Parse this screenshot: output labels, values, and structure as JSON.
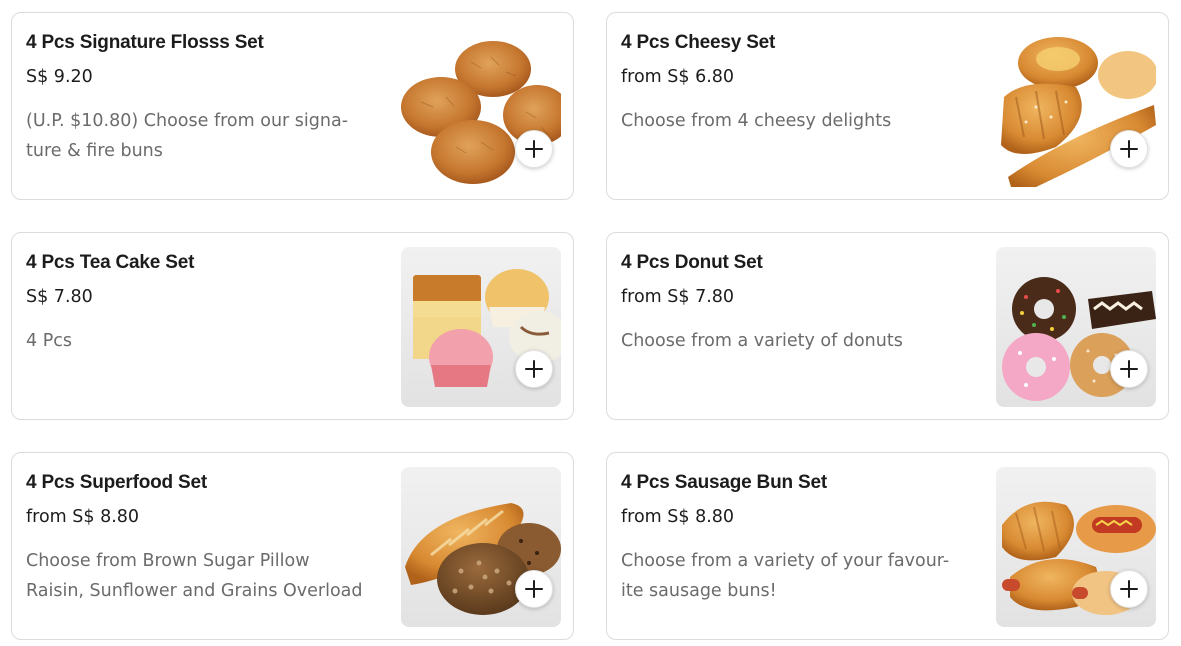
{
  "menu": {
    "items": [
      {
        "title": "4 Pcs Signature Flosss Set",
        "price": "S$ 9.20",
        "description_lines": [
          "(U.P. $10.80) Choose from our signa-",
          "ture & fire buns"
        ],
        "image": "floss-buns"
      },
      {
        "title": "4 Pcs Cheesy Set",
        "price": "from S$ 6.80",
        "description_lines": [
          "Choose from 4 cheesy delights",
          ""
        ],
        "image": "cheesy-breads"
      },
      {
        "title": "4 Pcs Tea Cake Set",
        "price": "S$ 7.80",
        "description_lines": [
          "4 Pcs",
          ""
        ],
        "image": "tea-cakes"
      },
      {
        "title": "4 Pcs Donut Set",
        "price": "from S$ 7.80",
        "description_lines": [
          "Choose from a variety of donuts",
          ""
        ],
        "image": "donuts"
      },
      {
        "title": "4 Pcs Superfood Set",
        "price": "from S$ 8.80",
        "description_lines": [
          "Choose from Brown Sugar Pillow",
          "Raisin, Sunflower and Grains Overload"
        ],
        "image": "superfood-breads"
      },
      {
        "title": "4 Pcs Sausage Bun Set",
        "price": "from S$ 8.80",
        "description_lines": [
          "Choose from a variety of your favour-",
          "ite sausage buns!"
        ],
        "image": "sausage-buns"
      }
    ],
    "add_icon": "plus-icon"
  },
  "colors": {
    "title_text": "#1c1c1c",
    "description_text": "#6b6b6b",
    "card_border": "#dcdcdc"
  }
}
